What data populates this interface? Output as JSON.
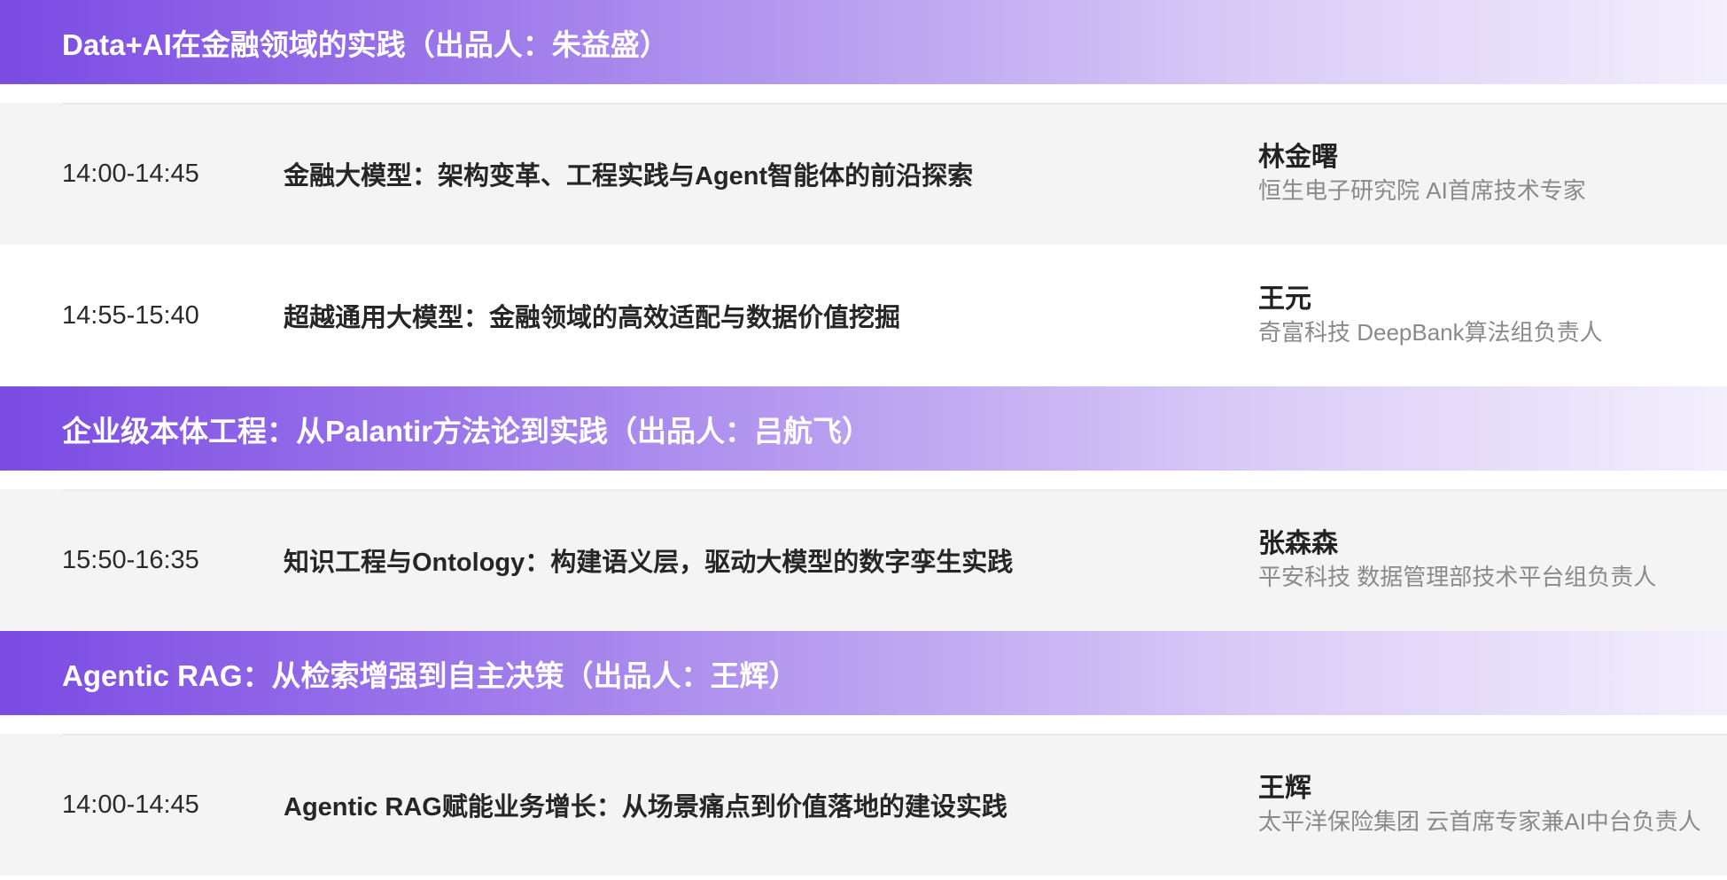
{
  "tracks": [
    {
      "title": "Data+AI在金融领域的实践（出品人：朱益盛）",
      "sessions": [
        {
          "time": "14:00-14:45",
          "title": "金融大模型：架构变革、工程实践与Agent智能体的前沿探索",
          "speaker": "林金曙",
          "role": "恒生电子研究院 AI首席技术专家"
        },
        {
          "time": "14:55-15:40",
          "title": "超越通用大模型：金融领域的高效适配与数据价值挖掘",
          "speaker": "王元",
          "role": "奇富科技 DeepBank算法组负责人"
        }
      ]
    },
    {
      "title": "企业级本体工程：从Palantir方法论到实践（出品人：吕航飞）",
      "sessions": [
        {
          "time": "15:50-16:35",
          "title": "知识工程与Ontology：构建语义层，驱动大模型的数字孪生实践",
          "speaker": "张森森",
          "role": "平安科技 数据管理部技术平台组负责人"
        }
      ]
    },
    {
      "title": "Agentic RAG：从检索增强到自主决策（出品人：王辉）",
      "sessions": [
        {
          "time": "14:00-14:45",
          "title": "Agentic RAG赋能业务增长：从场景痛点到价值落地的建设实践",
          "speaker": "王辉",
          "role": "太平洋保险集团 云首席专家兼AI中台负责人"
        }
      ]
    }
  ],
  "colors": {
    "track_gradient_start": "#7b4be3",
    "track_gradient_end": "#f3effc",
    "row_gray": "#f4f4f4",
    "speaker_role_text": "#8a8a8a"
  }
}
